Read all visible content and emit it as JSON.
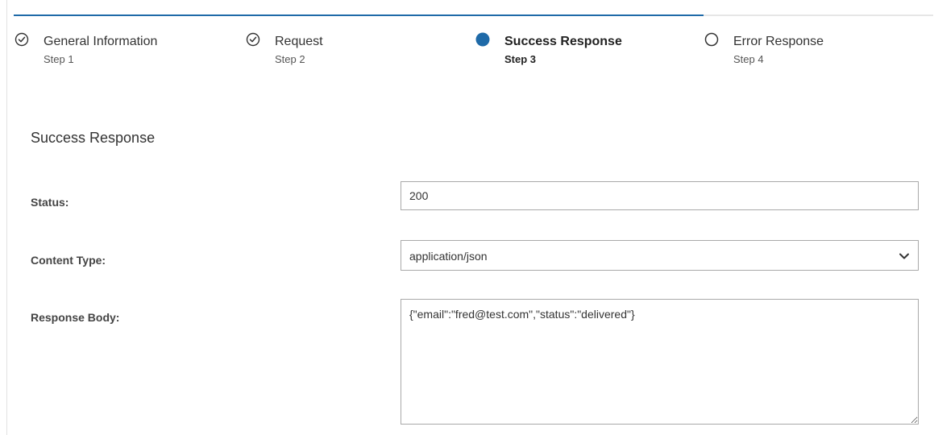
{
  "progress": {
    "completed_fraction": 0.75
  },
  "steps": [
    {
      "title": "General Information",
      "subtitle": "Step 1",
      "state": "complete",
      "icon": "check-circle-icon"
    },
    {
      "title": "Request",
      "subtitle": "Step 2",
      "state": "complete",
      "icon": "check-circle-icon"
    },
    {
      "title": "Success Response",
      "subtitle": "Step 3",
      "state": "active",
      "icon": "filled-circle-icon"
    },
    {
      "title": "Error Response",
      "subtitle": "Step 4",
      "state": "pending",
      "icon": "empty-circle-icon"
    }
  ],
  "section": {
    "title": "Success Response"
  },
  "form": {
    "status": {
      "label": "Status:",
      "value": "200"
    },
    "content_type": {
      "label": "Content Type:",
      "value": "application/json"
    },
    "response_body": {
      "label": "Response Body:",
      "value": "{\"email\":\"fred@test.com\",\"status\":\"delivered\"}"
    }
  },
  "colors": {
    "accent": "#1f6aa8",
    "track": "#e6e6e6",
    "border": "#a9a9a9"
  }
}
